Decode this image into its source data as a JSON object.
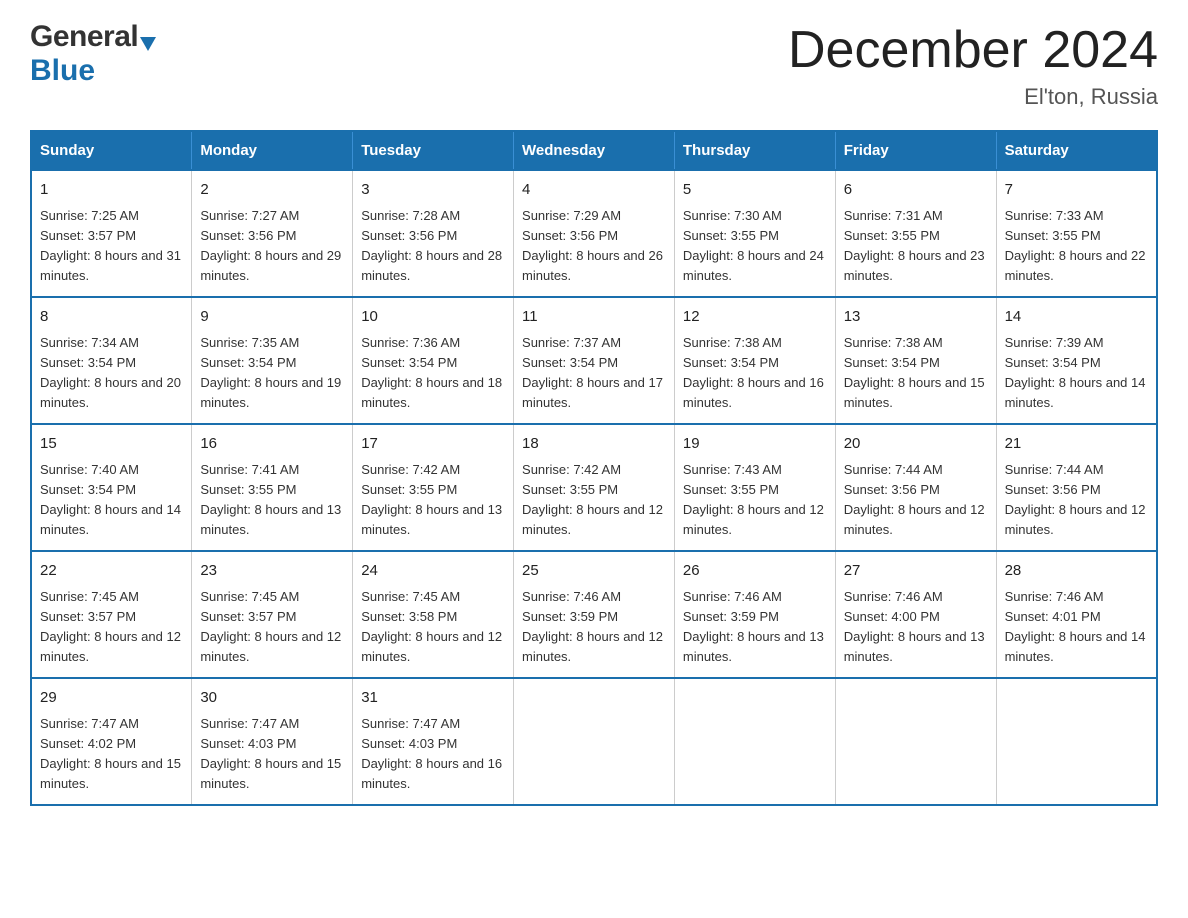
{
  "header": {
    "logo_general": "General",
    "logo_blue": "Blue",
    "month_title": "December 2024",
    "location": "El'ton, Russia"
  },
  "weekdays": [
    "Sunday",
    "Monday",
    "Tuesday",
    "Wednesday",
    "Thursday",
    "Friday",
    "Saturday"
  ],
  "weeks": [
    [
      {
        "day": "1",
        "sunrise": "Sunrise: 7:25 AM",
        "sunset": "Sunset: 3:57 PM",
        "daylight": "Daylight: 8 hours and 31 minutes."
      },
      {
        "day": "2",
        "sunrise": "Sunrise: 7:27 AM",
        "sunset": "Sunset: 3:56 PM",
        "daylight": "Daylight: 8 hours and 29 minutes."
      },
      {
        "day": "3",
        "sunrise": "Sunrise: 7:28 AM",
        "sunset": "Sunset: 3:56 PM",
        "daylight": "Daylight: 8 hours and 28 minutes."
      },
      {
        "day": "4",
        "sunrise": "Sunrise: 7:29 AM",
        "sunset": "Sunset: 3:56 PM",
        "daylight": "Daylight: 8 hours and 26 minutes."
      },
      {
        "day": "5",
        "sunrise": "Sunrise: 7:30 AM",
        "sunset": "Sunset: 3:55 PM",
        "daylight": "Daylight: 8 hours and 24 minutes."
      },
      {
        "day": "6",
        "sunrise": "Sunrise: 7:31 AM",
        "sunset": "Sunset: 3:55 PM",
        "daylight": "Daylight: 8 hours and 23 minutes."
      },
      {
        "day": "7",
        "sunrise": "Sunrise: 7:33 AM",
        "sunset": "Sunset: 3:55 PM",
        "daylight": "Daylight: 8 hours and 22 minutes."
      }
    ],
    [
      {
        "day": "8",
        "sunrise": "Sunrise: 7:34 AM",
        "sunset": "Sunset: 3:54 PM",
        "daylight": "Daylight: 8 hours and 20 minutes."
      },
      {
        "day": "9",
        "sunrise": "Sunrise: 7:35 AM",
        "sunset": "Sunset: 3:54 PM",
        "daylight": "Daylight: 8 hours and 19 minutes."
      },
      {
        "day": "10",
        "sunrise": "Sunrise: 7:36 AM",
        "sunset": "Sunset: 3:54 PM",
        "daylight": "Daylight: 8 hours and 18 minutes."
      },
      {
        "day": "11",
        "sunrise": "Sunrise: 7:37 AM",
        "sunset": "Sunset: 3:54 PM",
        "daylight": "Daylight: 8 hours and 17 minutes."
      },
      {
        "day": "12",
        "sunrise": "Sunrise: 7:38 AM",
        "sunset": "Sunset: 3:54 PM",
        "daylight": "Daylight: 8 hours and 16 minutes."
      },
      {
        "day": "13",
        "sunrise": "Sunrise: 7:38 AM",
        "sunset": "Sunset: 3:54 PM",
        "daylight": "Daylight: 8 hours and 15 minutes."
      },
      {
        "day": "14",
        "sunrise": "Sunrise: 7:39 AM",
        "sunset": "Sunset: 3:54 PM",
        "daylight": "Daylight: 8 hours and 14 minutes."
      }
    ],
    [
      {
        "day": "15",
        "sunrise": "Sunrise: 7:40 AM",
        "sunset": "Sunset: 3:54 PM",
        "daylight": "Daylight: 8 hours and 14 minutes."
      },
      {
        "day": "16",
        "sunrise": "Sunrise: 7:41 AM",
        "sunset": "Sunset: 3:55 PM",
        "daylight": "Daylight: 8 hours and 13 minutes."
      },
      {
        "day": "17",
        "sunrise": "Sunrise: 7:42 AM",
        "sunset": "Sunset: 3:55 PM",
        "daylight": "Daylight: 8 hours and 13 minutes."
      },
      {
        "day": "18",
        "sunrise": "Sunrise: 7:42 AM",
        "sunset": "Sunset: 3:55 PM",
        "daylight": "Daylight: 8 hours and 12 minutes."
      },
      {
        "day": "19",
        "sunrise": "Sunrise: 7:43 AM",
        "sunset": "Sunset: 3:55 PM",
        "daylight": "Daylight: 8 hours and 12 minutes."
      },
      {
        "day": "20",
        "sunrise": "Sunrise: 7:44 AM",
        "sunset": "Sunset: 3:56 PM",
        "daylight": "Daylight: 8 hours and 12 minutes."
      },
      {
        "day": "21",
        "sunrise": "Sunrise: 7:44 AM",
        "sunset": "Sunset: 3:56 PM",
        "daylight": "Daylight: 8 hours and 12 minutes."
      }
    ],
    [
      {
        "day": "22",
        "sunrise": "Sunrise: 7:45 AM",
        "sunset": "Sunset: 3:57 PM",
        "daylight": "Daylight: 8 hours and 12 minutes."
      },
      {
        "day": "23",
        "sunrise": "Sunrise: 7:45 AM",
        "sunset": "Sunset: 3:57 PM",
        "daylight": "Daylight: 8 hours and 12 minutes."
      },
      {
        "day": "24",
        "sunrise": "Sunrise: 7:45 AM",
        "sunset": "Sunset: 3:58 PM",
        "daylight": "Daylight: 8 hours and 12 minutes."
      },
      {
        "day": "25",
        "sunrise": "Sunrise: 7:46 AM",
        "sunset": "Sunset: 3:59 PM",
        "daylight": "Daylight: 8 hours and 12 minutes."
      },
      {
        "day": "26",
        "sunrise": "Sunrise: 7:46 AM",
        "sunset": "Sunset: 3:59 PM",
        "daylight": "Daylight: 8 hours and 13 minutes."
      },
      {
        "day": "27",
        "sunrise": "Sunrise: 7:46 AM",
        "sunset": "Sunset: 4:00 PM",
        "daylight": "Daylight: 8 hours and 13 minutes."
      },
      {
        "day": "28",
        "sunrise": "Sunrise: 7:46 AM",
        "sunset": "Sunset: 4:01 PM",
        "daylight": "Daylight: 8 hours and 14 minutes."
      }
    ],
    [
      {
        "day": "29",
        "sunrise": "Sunrise: 7:47 AM",
        "sunset": "Sunset: 4:02 PM",
        "daylight": "Daylight: 8 hours and 15 minutes."
      },
      {
        "day": "30",
        "sunrise": "Sunrise: 7:47 AM",
        "sunset": "Sunset: 4:03 PM",
        "daylight": "Daylight: 8 hours and 15 minutes."
      },
      {
        "day": "31",
        "sunrise": "Sunrise: 7:47 AM",
        "sunset": "Sunset: 4:03 PM",
        "daylight": "Daylight: 8 hours and 16 minutes."
      },
      null,
      null,
      null,
      null
    ]
  ]
}
